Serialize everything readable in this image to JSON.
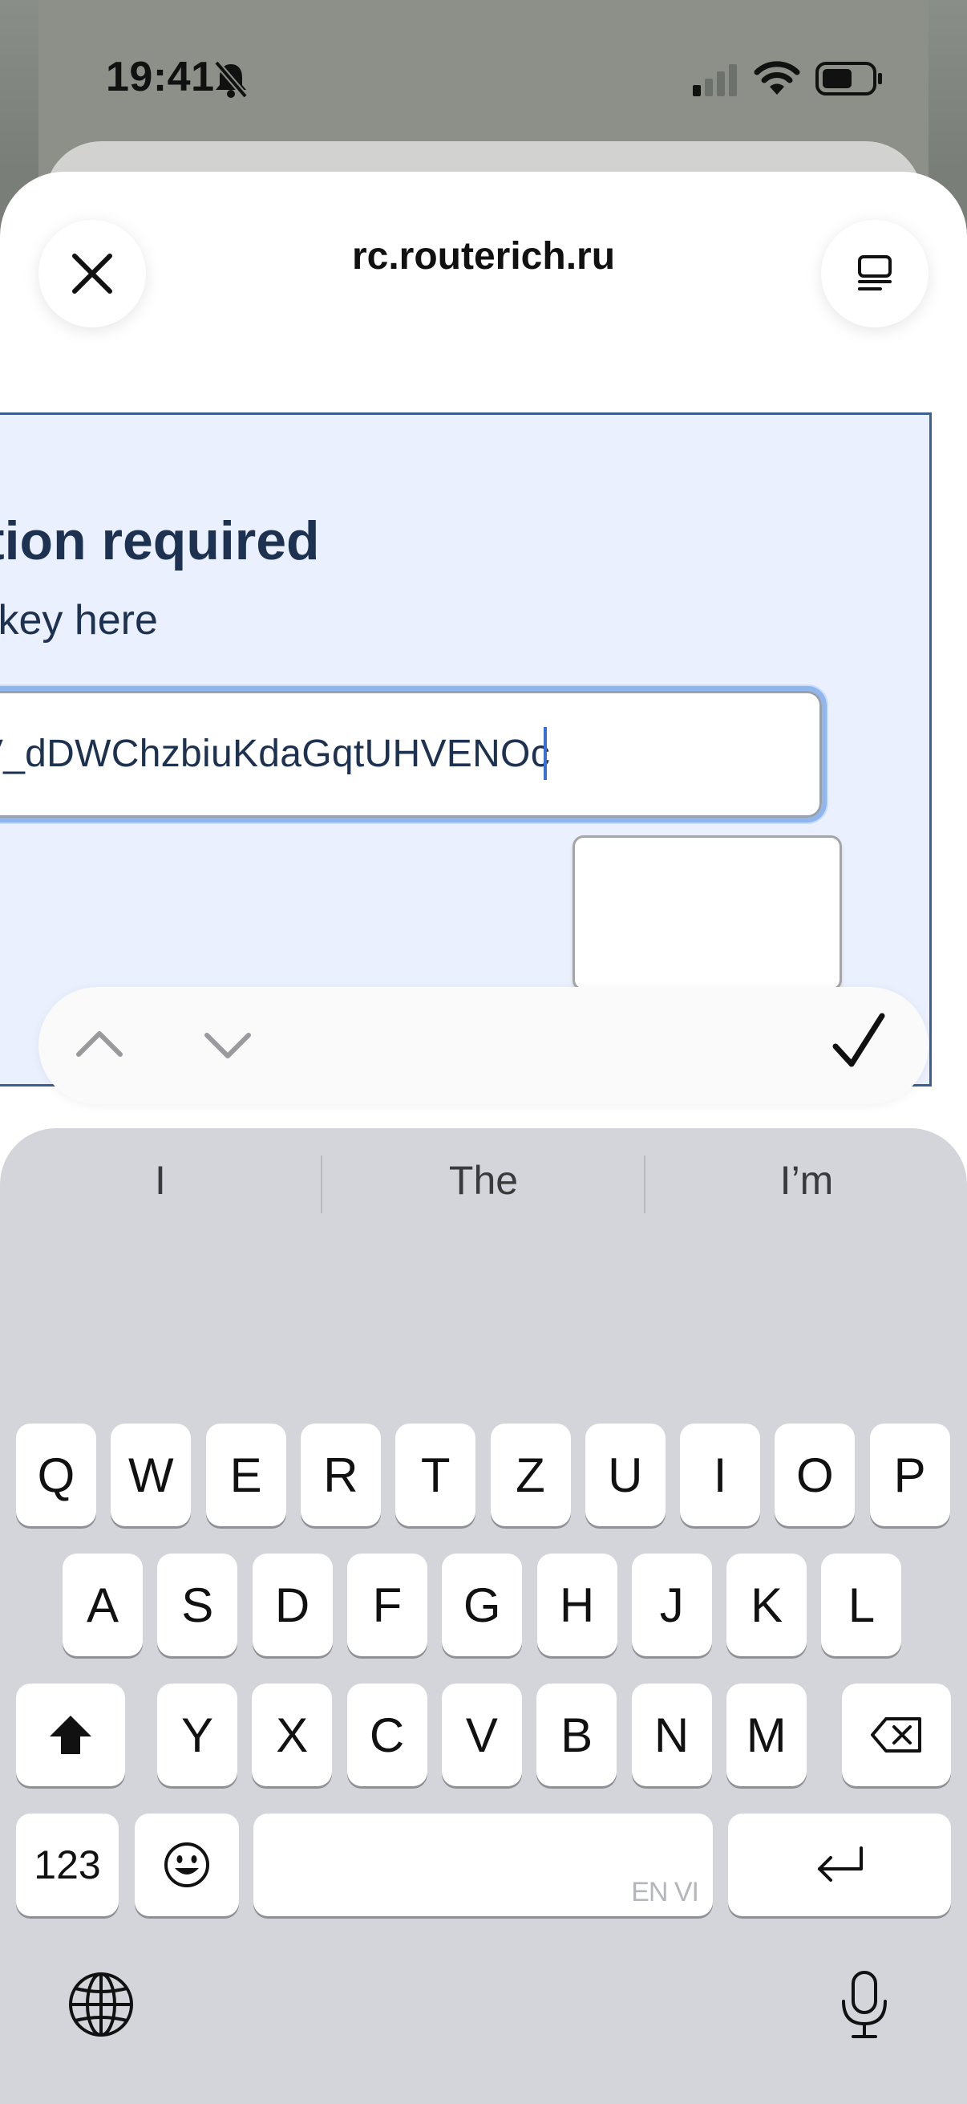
{
  "status_bar": {
    "time": "19:41",
    "icons": [
      "bell-slash-icon",
      "cellular-signal-icon",
      "wifi-icon",
      "battery-icon"
    ]
  },
  "sheet": {
    "title": "rc.routerich.ru",
    "close_icon": "close-icon",
    "menu_icon": "reader-mode-icon"
  },
  "page": {
    "heading": "tion required",
    "subheading": "key here:",
    "key_input_value": "V_dDWChzbiuKdaGqtUHVENOc",
    "submit_label": ""
  },
  "accessory_bar": {
    "prev_icon": "chevron-up-icon",
    "next_icon": "chevron-down-icon",
    "done_icon": "checkmark-icon"
  },
  "keyboard": {
    "suggestions": [
      "I",
      "The",
      "I’m"
    ],
    "row1": [
      "Q",
      "W",
      "E",
      "R",
      "T",
      "Z",
      "U",
      "I",
      "O",
      "P"
    ],
    "row2": [
      "A",
      "S",
      "D",
      "F",
      "G",
      "H",
      "J",
      "K",
      "L"
    ],
    "row3": [
      "Y",
      "X",
      "C",
      "V",
      "B",
      "N",
      "M"
    ],
    "numbers_label": "123",
    "space_hint": "EN VI",
    "colors": {
      "background": "#d4d5da",
      "key": "#ffffff",
      "accent": "#3a6fd8"
    }
  }
}
